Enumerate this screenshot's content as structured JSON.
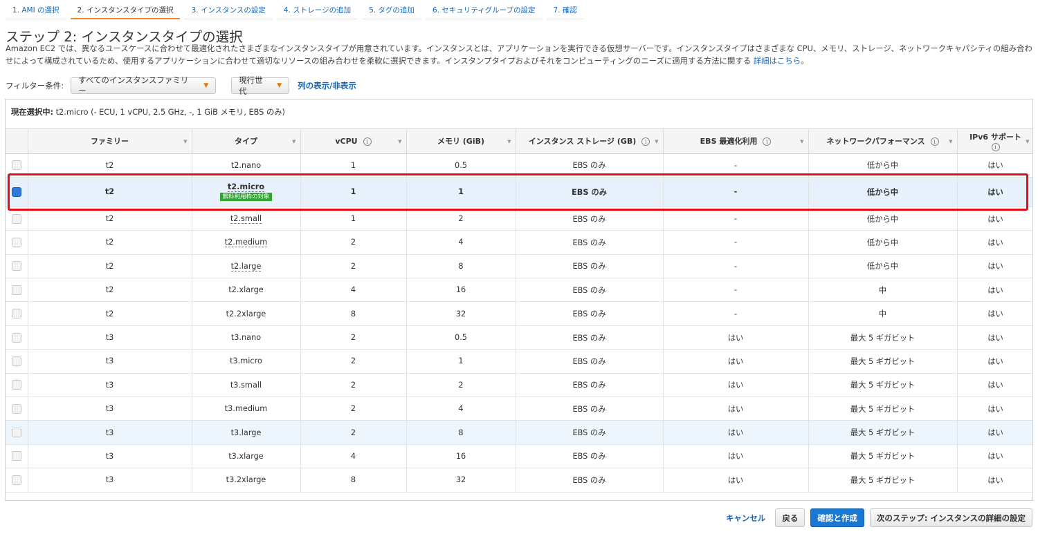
{
  "tabs": [
    "1. AMI の選択",
    "2. インスタンスタイプの選択",
    "3. インスタンスの設定",
    "4. ストレージの追加",
    "5. タグの追加",
    "6. セキュリティグループの設定",
    "7. 確認"
  ],
  "step_title": "ステップ 2: インスタンスタイプの選択",
  "description": "Amazon EC2 では、異なるユースケースに合わせて最適化されたさまざまなインスタンスタイプが用意されています。インスタンスとは、アプリケーションを実行できる仮想サーバーです。インスタンスタイプはさまざまな CPU、メモリ、ストレージ、ネットワークキャパシティの組み合わせによって構成されているため、使用するアプリケーションに合わせて適切なリソースの組み合わせを柔軟に選択できます。インスタンプタイプおよびそれをコンピューティングのニーズに適用する方法に関する",
  "description_link": "詳細はこちら",
  "description_end": "。",
  "filter": {
    "label": "フィルター条件:",
    "family_select": "すべてのインスタンスファミリー",
    "generation_select": "現行世代",
    "columns_link": "列の表示/非表示"
  },
  "current_label": "現在選択中:",
  "current_value": "t2.micro (- ECU, 1 vCPU, 2.5 GHz, -, 1 GiB メモリ, EBS のみ)",
  "columns": [
    "ファミリー",
    "タイプ",
    "vCPU",
    "メモリ (GiB)",
    "インスタンス ストレージ (GB)",
    "EBS 最適化利用",
    "ネットワークパフォーマンス",
    "IPv6 サポート"
  ],
  "free_tier_badge": "無料利用枠の対象",
  "rows": [
    {
      "family": "t2",
      "type": "t2.nano",
      "vcpu": "1",
      "mem": "0.5",
      "storage": "EBS のみ",
      "ebs": "-",
      "net": "低から中",
      "ipv6": "はい"
    },
    {
      "family": "t2",
      "type": "t2.micro",
      "vcpu": "1",
      "mem": "1",
      "storage": "EBS のみ",
      "ebs": "-",
      "net": "低から中",
      "ipv6": "はい"
    },
    {
      "family": "t2",
      "type": "t2.small",
      "vcpu": "1",
      "mem": "2",
      "storage": "EBS のみ",
      "ebs": "-",
      "net": "低から中",
      "ipv6": "はい"
    },
    {
      "family": "t2",
      "type": "t2.medium",
      "vcpu": "2",
      "mem": "4",
      "storage": "EBS のみ",
      "ebs": "-",
      "net": "低から中",
      "ipv6": "はい"
    },
    {
      "family": "t2",
      "type": "t2.large",
      "vcpu": "2",
      "mem": "8",
      "storage": "EBS のみ",
      "ebs": "-",
      "net": "低から中",
      "ipv6": "はい"
    },
    {
      "family": "t2",
      "type": "t2.xlarge",
      "vcpu": "4",
      "mem": "16",
      "storage": "EBS のみ",
      "ebs": "-",
      "net": "中",
      "ipv6": "はい"
    },
    {
      "family": "t2",
      "type": "t2.2xlarge",
      "vcpu": "8",
      "mem": "32",
      "storage": "EBS のみ",
      "ebs": "-",
      "net": "中",
      "ipv6": "はい"
    },
    {
      "family": "t3",
      "type": "t3.nano",
      "vcpu": "2",
      "mem": "0.5",
      "storage": "EBS のみ",
      "ebs": "はい",
      "net": "最大 5 ギガビット",
      "ipv6": "はい"
    },
    {
      "family": "t3",
      "type": "t3.micro",
      "vcpu": "2",
      "mem": "1",
      "storage": "EBS のみ",
      "ebs": "はい",
      "net": "最大 5 ギガビット",
      "ipv6": "はい"
    },
    {
      "family": "t3",
      "type": "t3.small",
      "vcpu": "2",
      "mem": "2",
      "storage": "EBS のみ",
      "ebs": "はい",
      "net": "最大 5 ギガビット",
      "ipv6": "はい"
    },
    {
      "family": "t3",
      "type": "t3.medium",
      "vcpu": "2",
      "mem": "4",
      "storage": "EBS のみ",
      "ebs": "はい",
      "net": "最大 5 ギガビット",
      "ipv6": "はい"
    },
    {
      "family": "t3",
      "type": "t3.large",
      "vcpu": "2",
      "mem": "8",
      "storage": "EBS のみ",
      "ebs": "はい",
      "net": "最大 5 ギガビット",
      "ipv6": "はい"
    },
    {
      "family": "t3",
      "type": "t3.xlarge",
      "vcpu": "4",
      "mem": "16",
      "storage": "EBS のみ",
      "ebs": "はい",
      "net": "最大 5 ギガビット",
      "ipv6": "はい"
    },
    {
      "family": "t3",
      "type": "t3.2xlarge",
      "vcpu": "8",
      "mem": "32",
      "storage": "EBS のみ",
      "ebs": "はい",
      "net": "最大 5 ギガビット",
      "ipv6": "はい"
    }
  ],
  "footer": {
    "cancel": "キャンセル",
    "back": "戻る",
    "review_launch": "確認と作成",
    "next": "次のステップ: インスタンスの詳細の設定"
  },
  "colors": {
    "link": "#1166bb",
    "primary_button": "#1a78d2",
    "highlight_border": "#e30d18",
    "badge": "#2fa52f",
    "active_tab": "#f08c2e"
  }
}
